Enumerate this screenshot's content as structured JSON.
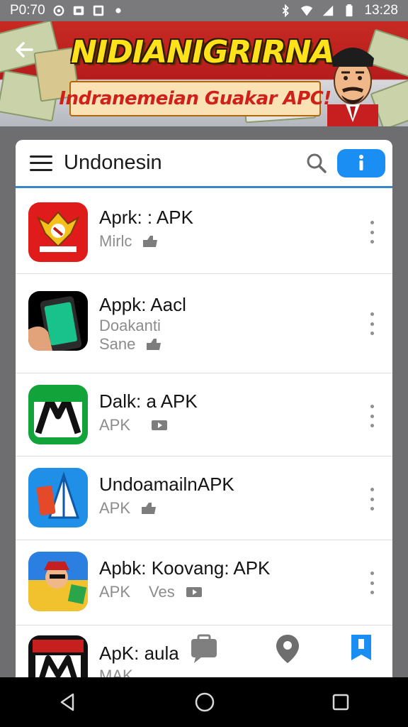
{
  "status_bar": {
    "left_text": "P0:70",
    "time": "13:28"
  },
  "banner": {
    "title": "NIDIANIGRIRNA",
    "subtitle": "Indranemeian Guakar APC!"
  },
  "header": {
    "title": "Undonesin"
  },
  "apps": [
    {
      "name": "Aprk: : APK",
      "line2": "Mirlc",
      "line3": ""
    },
    {
      "name": "Appk: Aacl",
      "line2": "Doakanti",
      "line3": "Sane"
    },
    {
      "name": "Dalk: a APK",
      "line2": "APK",
      "line3": ""
    },
    {
      "name": "UndoamailnAPK",
      "line2": "APK",
      "line3": ""
    },
    {
      "name": "Apbk: Koovang: APK",
      "line2": "APK",
      "line2b": "Ves",
      "line3": ""
    },
    {
      "name": "ApK: aula",
      "line2": "MAK",
      "line3": ""
    }
  ],
  "icons": {
    "back": "arrow-left-icon",
    "menu": "hamburger-icon",
    "search": "search-icon",
    "info": "info-icon",
    "more": "more-vert-icon",
    "nav_back": "triangle-back-icon",
    "nav_home": "circle-home-icon",
    "nav_recent": "square-recents-icon"
  },
  "colors": {
    "accent": "#1a8ef2",
    "banner_red": "#c72a23",
    "banner_yellow": "#ffe21a",
    "divider_blue": "#3a86c8"
  }
}
